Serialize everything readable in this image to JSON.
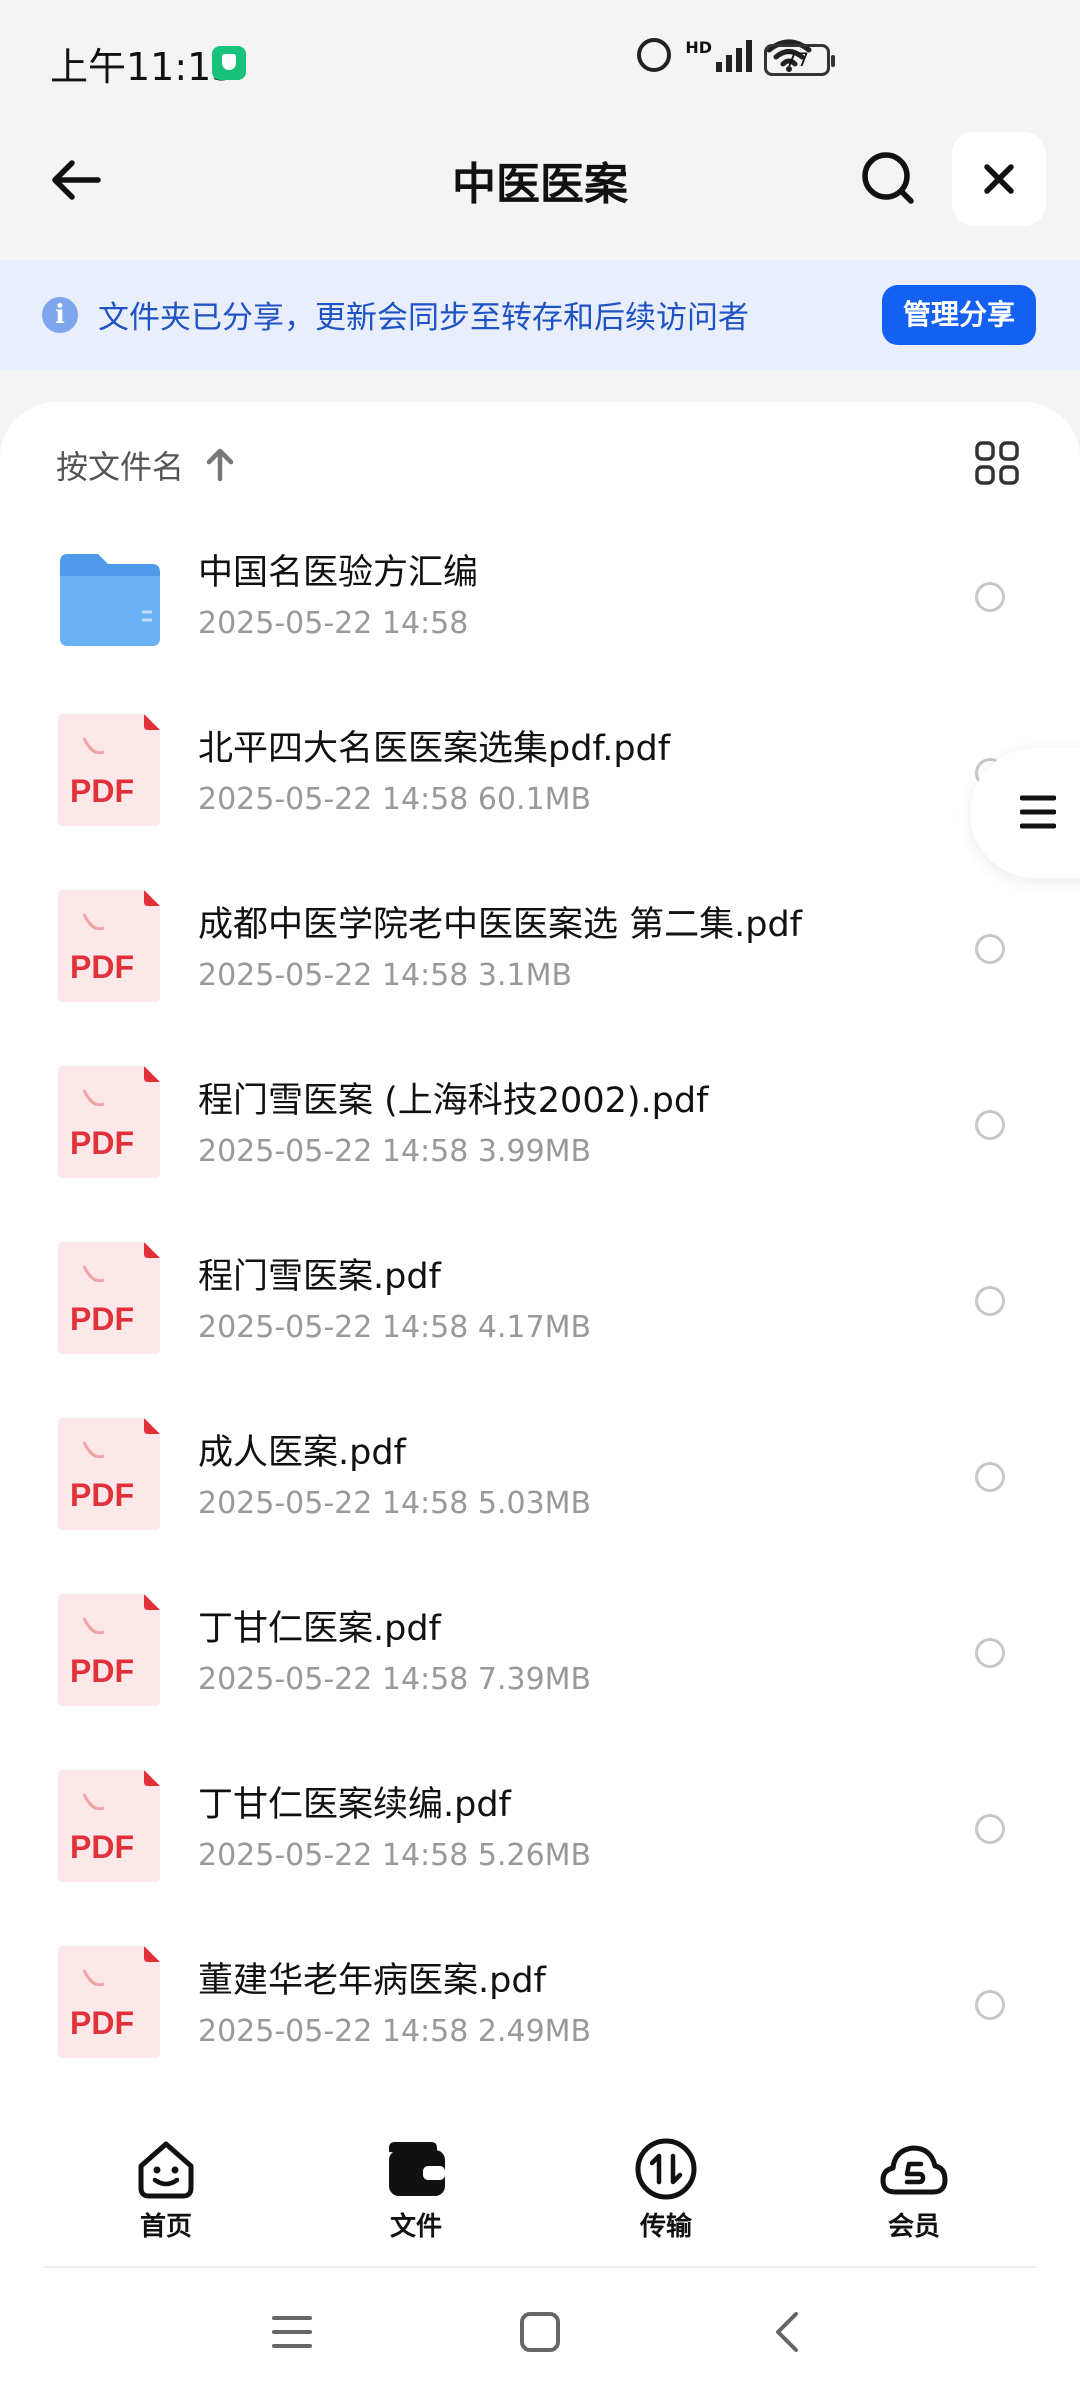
{
  "status_bar": {
    "time": "上午11:15",
    "network": "HD",
    "battery": "77"
  },
  "header": {
    "title": "中医医案"
  },
  "banner": {
    "text": "文件夹已分享，更新会同步至转存和后续访问者",
    "button": "管理分享"
  },
  "sort": {
    "label": "按文件名"
  },
  "files": [
    {
      "name": "中国名医验方汇编",
      "meta": "2025-05-22 14:58",
      "type": "folder"
    },
    {
      "name": "北平四大名医医案选集pdf.pdf",
      "meta": "2025-05-22 14:58  60.1MB",
      "type": "pdf"
    },
    {
      "name": "成都中医学院老中医医案选  第二集.pdf",
      "meta": "2025-05-22 14:58  3.1MB",
      "type": "pdf"
    },
    {
      "name": "程门雪医案 (上海科技2002).pdf",
      "meta": "2025-05-22 14:58  3.99MB",
      "type": "pdf"
    },
    {
      "name": "程门雪医案.pdf",
      "meta": "2025-05-22 14:58  4.17MB",
      "type": "pdf"
    },
    {
      "name": "成人医案.pdf",
      "meta": "2025-05-22 14:58  5.03MB",
      "type": "pdf"
    },
    {
      "name": "丁甘仁医案.pdf",
      "meta": "2025-05-22 14:58  7.39MB",
      "type": "pdf"
    },
    {
      "name": "丁甘仁医案续编.pdf",
      "meta": "2025-05-22 14:58  5.26MB",
      "type": "pdf"
    },
    {
      "name": "董建华老年病医案.pdf",
      "meta": "2025-05-22 14:58  2.49MB",
      "type": "pdf"
    }
  ],
  "pdf_label": "PDF",
  "tabs": [
    {
      "label": "首页",
      "icon": "home-face-icon"
    },
    {
      "label": "文件",
      "icon": "wallet-folder-icon"
    },
    {
      "label": "传输",
      "icon": "transfer-icon"
    },
    {
      "label": "会员",
      "icon": "vip-cloud-icon"
    }
  ],
  "colors": {
    "accent": "#1460f2",
    "banner_bg": "#e8eefb",
    "pdf_red": "#e0313a",
    "folder_blue": "#5aa6f0"
  }
}
